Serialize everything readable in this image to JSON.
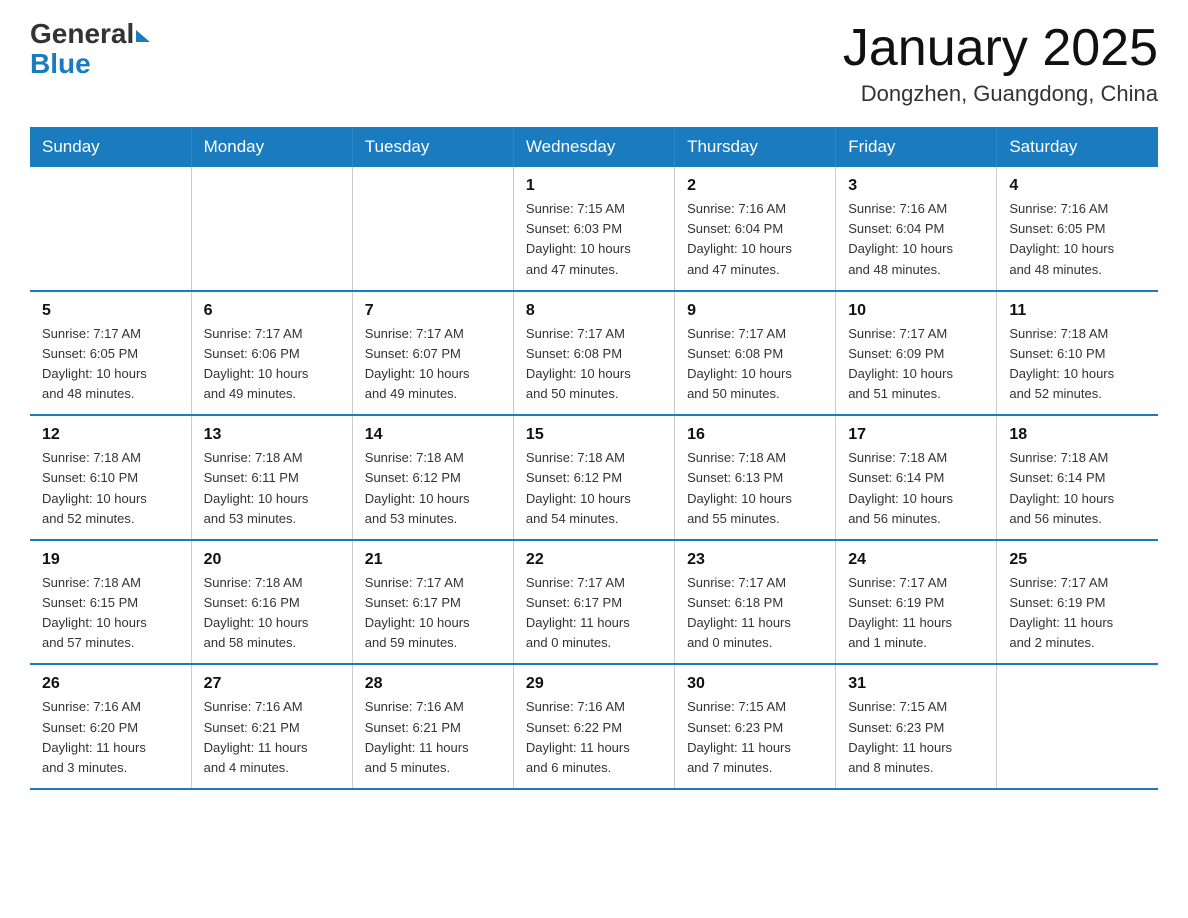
{
  "header": {
    "logo_general": "General",
    "logo_blue": "Blue",
    "month_title": "January 2025",
    "location": "Dongzhen, Guangdong, China"
  },
  "weekdays": [
    "Sunday",
    "Monday",
    "Tuesday",
    "Wednesday",
    "Thursday",
    "Friday",
    "Saturday"
  ],
  "weeks": [
    [
      {
        "day": "",
        "info": ""
      },
      {
        "day": "",
        "info": ""
      },
      {
        "day": "",
        "info": ""
      },
      {
        "day": "1",
        "info": "Sunrise: 7:15 AM\nSunset: 6:03 PM\nDaylight: 10 hours\nand 47 minutes."
      },
      {
        "day": "2",
        "info": "Sunrise: 7:16 AM\nSunset: 6:04 PM\nDaylight: 10 hours\nand 47 minutes."
      },
      {
        "day": "3",
        "info": "Sunrise: 7:16 AM\nSunset: 6:04 PM\nDaylight: 10 hours\nand 48 minutes."
      },
      {
        "day": "4",
        "info": "Sunrise: 7:16 AM\nSunset: 6:05 PM\nDaylight: 10 hours\nand 48 minutes."
      }
    ],
    [
      {
        "day": "5",
        "info": "Sunrise: 7:17 AM\nSunset: 6:05 PM\nDaylight: 10 hours\nand 48 minutes."
      },
      {
        "day": "6",
        "info": "Sunrise: 7:17 AM\nSunset: 6:06 PM\nDaylight: 10 hours\nand 49 minutes."
      },
      {
        "day": "7",
        "info": "Sunrise: 7:17 AM\nSunset: 6:07 PM\nDaylight: 10 hours\nand 49 minutes."
      },
      {
        "day": "8",
        "info": "Sunrise: 7:17 AM\nSunset: 6:08 PM\nDaylight: 10 hours\nand 50 minutes."
      },
      {
        "day": "9",
        "info": "Sunrise: 7:17 AM\nSunset: 6:08 PM\nDaylight: 10 hours\nand 50 minutes."
      },
      {
        "day": "10",
        "info": "Sunrise: 7:17 AM\nSunset: 6:09 PM\nDaylight: 10 hours\nand 51 minutes."
      },
      {
        "day": "11",
        "info": "Sunrise: 7:18 AM\nSunset: 6:10 PM\nDaylight: 10 hours\nand 52 minutes."
      }
    ],
    [
      {
        "day": "12",
        "info": "Sunrise: 7:18 AM\nSunset: 6:10 PM\nDaylight: 10 hours\nand 52 minutes."
      },
      {
        "day": "13",
        "info": "Sunrise: 7:18 AM\nSunset: 6:11 PM\nDaylight: 10 hours\nand 53 minutes."
      },
      {
        "day": "14",
        "info": "Sunrise: 7:18 AM\nSunset: 6:12 PM\nDaylight: 10 hours\nand 53 minutes."
      },
      {
        "day": "15",
        "info": "Sunrise: 7:18 AM\nSunset: 6:12 PM\nDaylight: 10 hours\nand 54 minutes."
      },
      {
        "day": "16",
        "info": "Sunrise: 7:18 AM\nSunset: 6:13 PM\nDaylight: 10 hours\nand 55 minutes."
      },
      {
        "day": "17",
        "info": "Sunrise: 7:18 AM\nSunset: 6:14 PM\nDaylight: 10 hours\nand 56 minutes."
      },
      {
        "day": "18",
        "info": "Sunrise: 7:18 AM\nSunset: 6:14 PM\nDaylight: 10 hours\nand 56 minutes."
      }
    ],
    [
      {
        "day": "19",
        "info": "Sunrise: 7:18 AM\nSunset: 6:15 PM\nDaylight: 10 hours\nand 57 minutes."
      },
      {
        "day": "20",
        "info": "Sunrise: 7:18 AM\nSunset: 6:16 PM\nDaylight: 10 hours\nand 58 minutes."
      },
      {
        "day": "21",
        "info": "Sunrise: 7:17 AM\nSunset: 6:17 PM\nDaylight: 10 hours\nand 59 minutes."
      },
      {
        "day": "22",
        "info": "Sunrise: 7:17 AM\nSunset: 6:17 PM\nDaylight: 11 hours\nand 0 minutes."
      },
      {
        "day": "23",
        "info": "Sunrise: 7:17 AM\nSunset: 6:18 PM\nDaylight: 11 hours\nand 0 minutes."
      },
      {
        "day": "24",
        "info": "Sunrise: 7:17 AM\nSunset: 6:19 PM\nDaylight: 11 hours\nand 1 minute."
      },
      {
        "day": "25",
        "info": "Sunrise: 7:17 AM\nSunset: 6:19 PM\nDaylight: 11 hours\nand 2 minutes."
      }
    ],
    [
      {
        "day": "26",
        "info": "Sunrise: 7:16 AM\nSunset: 6:20 PM\nDaylight: 11 hours\nand 3 minutes."
      },
      {
        "day": "27",
        "info": "Sunrise: 7:16 AM\nSunset: 6:21 PM\nDaylight: 11 hours\nand 4 minutes."
      },
      {
        "day": "28",
        "info": "Sunrise: 7:16 AM\nSunset: 6:21 PM\nDaylight: 11 hours\nand 5 minutes."
      },
      {
        "day": "29",
        "info": "Sunrise: 7:16 AM\nSunset: 6:22 PM\nDaylight: 11 hours\nand 6 minutes."
      },
      {
        "day": "30",
        "info": "Sunrise: 7:15 AM\nSunset: 6:23 PM\nDaylight: 11 hours\nand 7 minutes."
      },
      {
        "day": "31",
        "info": "Sunrise: 7:15 AM\nSunset: 6:23 PM\nDaylight: 11 hours\nand 8 minutes."
      },
      {
        "day": "",
        "info": ""
      }
    ]
  ]
}
